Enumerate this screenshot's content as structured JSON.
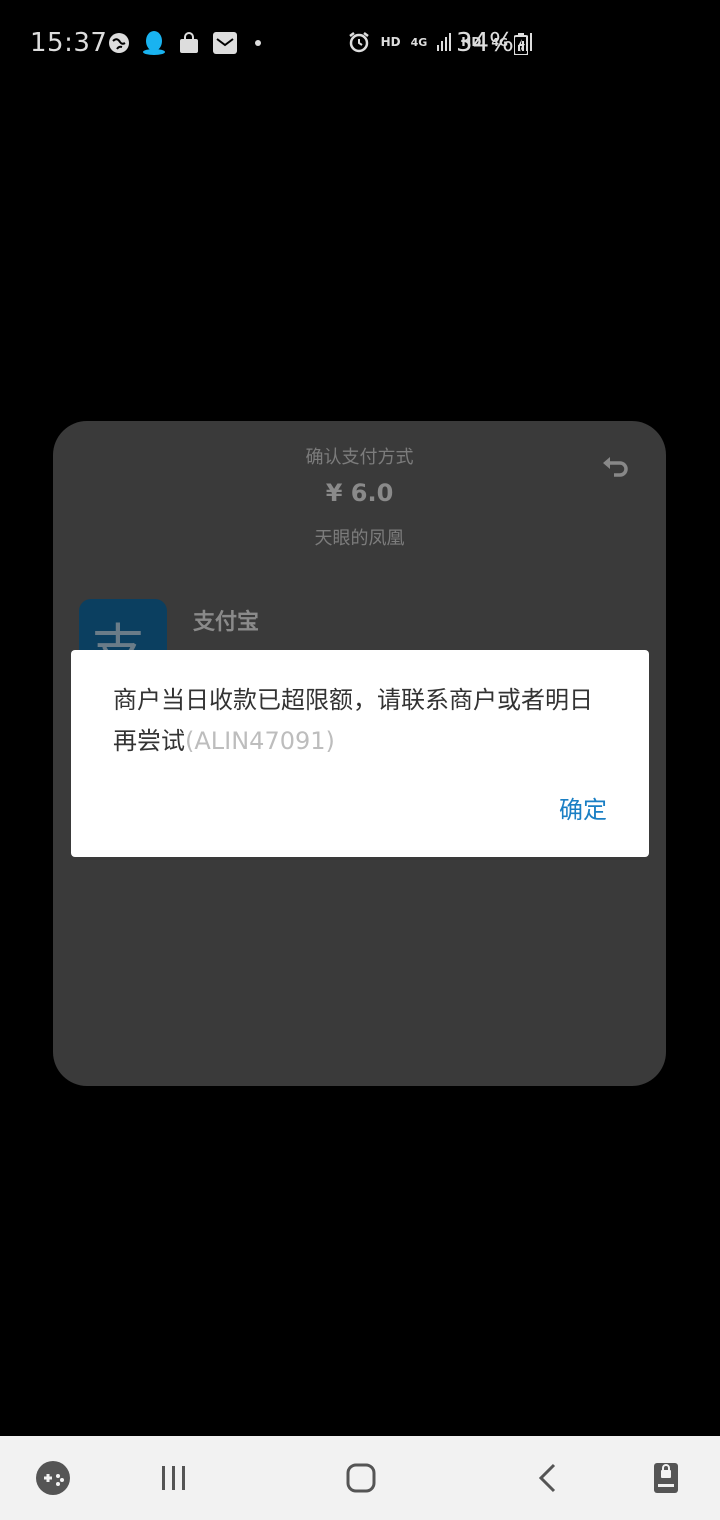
{
  "status_bar": {
    "time": "15:37",
    "hd_1": "HD",
    "net_1": "4G",
    "hd_2": "HD",
    "net_2": "4G",
    "battery": "34%"
  },
  "sheet": {
    "title": "确认支付方式",
    "amount": "¥ 6.0",
    "merchant": "天眼的凤凰",
    "method_label": "支付宝",
    "method_icon_char": "支"
  },
  "dialog": {
    "message": "商户当日收款已超限额，请联系商户或者明日再尝试",
    "error_code": "(ALIN47091)",
    "confirm_label": "确定"
  },
  "colors": {
    "dialog_button": "#1a7fc4",
    "sheet_bg": "#3a3a3a",
    "navbar_bg": "#f2f2f2"
  }
}
